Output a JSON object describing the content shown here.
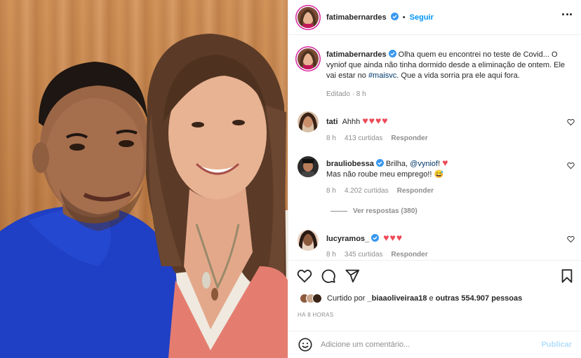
{
  "post": {
    "author": "fatimabernardes",
    "follow_label": "Seguir",
    "separator": "•",
    "caption_author": "fatimabernardes",
    "caption_text": "Olha quem eu encontrei no teste de Covid... O vyniof que ainda não tinha dormido desde a eliminação de ontem. Ele vai estar no",
    "caption_hashtag": "#maisvc",
    "caption_end": ". Que a vida sorria pra ele aqui fora.",
    "edited": "Editado · 8 h"
  },
  "comments": [
    {
      "user": "tati",
      "text": "Ahhh",
      "hearts": "♥♥♥♥",
      "time": "8 h",
      "likes": "413 curtidas",
      "reply": "Responder"
    },
    {
      "user": "brauliobessa",
      "text_pre": "Brilha, ",
      "mention": "@vyniof",
      "text_post": "! ",
      "hearts": "♥",
      "line2": "Mas não roube meu emprego!! 😅",
      "time": "8 h",
      "likes": "4.202 curtidas",
      "reply": "Responder"
    },
    {
      "user": "lucyramos_",
      "hearts": "♥♥♥",
      "time": "8 h",
      "likes": "345 curtidas",
      "reply": "Responder"
    }
  ],
  "view_replies": "Ver respostas (380)",
  "likes_summary": {
    "prefix": "Curtido por ",
    "user": "_biaaoliveiraa18",
    "middle": " e ",
    "others": "outras 554.907 pessoas"
  },
  "timestamp": "HÁ 8 HORAS",
  "add_comment": {
    "placeholder": "Adicione um comentário...",
    "publish_label": "Publicar"
  },
  "icons": {
    "verified": "verified-badge-icon",
    "more": "more-options-icon",
    "like": "heart-icon",
    "comment": "comment-icon",
    "share": "share-icon",
    "save": "bookmark-icon",
    "emoji": "emoji-icon"
  },
  "colors": {
    "accent": "#0095f6",
    "heart": "#ed4956",
    "muted": "#8e8e8e",
    "publish_disabled": "#b2dffc",
    "story_ring": "#d6249f"
  }
}
